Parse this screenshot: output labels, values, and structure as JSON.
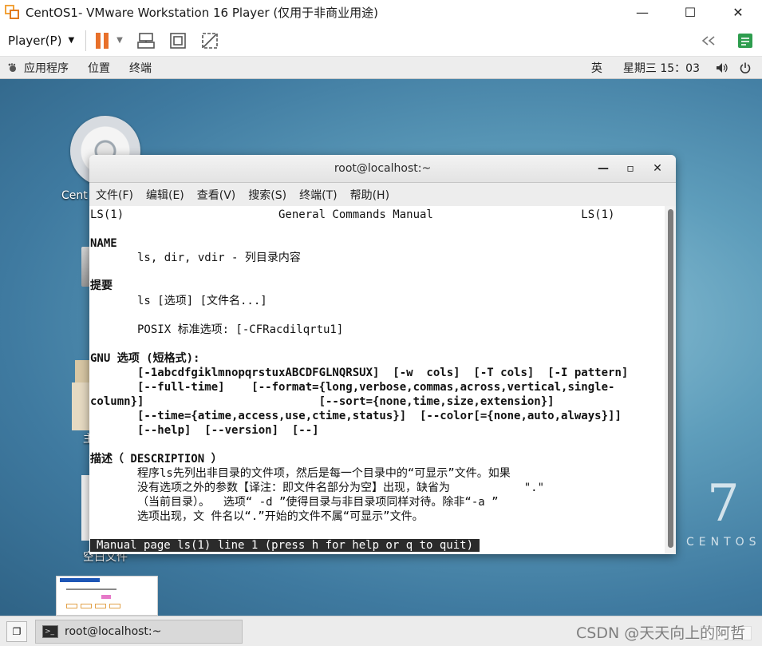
{
  "vmware": {
    "title": "CentOS1- VMware Workstation 16 Player (仅用于非商业用途)",
    "player_menu": "Player(P)",
    "controls": {
      "minimize": "—",
      "maximize": "☐",
      "close": "✕"
    }
  },
  "gnome": {
    "apps": "应用程序",
    "places": "位置",
    "terminal": "终端",
    "input_method": "英",
    "clock": "星期三 15：03"
  },
  "desktop": {
    "partial_label_cd": "Cent",
    "partial_label_folder": "主",
    "label_empty_file": "空白文件",
    "centos_seven": "7",
    "centos_word": "CENTOS"
  },
  "terminal": {
    "title": "root@localhost:~",
    "menu": [
      "文件(F)",
      "编辑(E)",
      "查看(V)",
      "搜索(S)",
      "终端(T)",
      "帮助(H)"
    ],
    "controls": {
      "minimize": "—",
      "maximize": "▫",
      "close": "✕"
    },
    "lines": {
      "header": "LS(1)                       General Commands Manual                      LS(1)",
      "name_heading": "NAME",
      "name_text": "       ls, dir, vdir - 列目录内容",
      "synopsis_heading": "提要",
      "synopsis_1": "       ls [选项] [文件名...]",
      "synopsis_2": "       POSIX 标准选项: [-CFRacdilqrtu1]",
      "gnu_heading": "GNU 选项 (短格式):",
      "gnu_1": "       [-1abcdfgiklmnopqrstuxABCDFGLNQRSUX]  [-w  cols]  [-T cols]  [-I pattern]",
      "gnu_2": "       [--full-time]    [--format={long,verbose,commas,across,vertical,single-",
      "gnu_3": "column}]                          [--sort={none,time,size,extension}]",
      "gnu_4": "       [--time={atime,access,use,ctime,status}]  [--color[={none,auto,always}]]",
      "gnu_5": "       [--help]  [--version]  [--]",
      "desc_heading": "描述（ DESCRIPTION ）",
      "desc_1": "       程序ls先列出非目录的文件项，然后是每一个目录中的“可显示”文件。如果",
      "desc_2": "       没有选项之外的参数【译注：即文件名部分为空】出现，缺省为           \".\"",
      "desc_3": "       （当前目录）。  选项“ -d ”使得目录与非目录项同样对待。除非“-a ”",
      "desc_4": "       选项出现，文 件名以“.”开始的文件不属“可显示”文件。",
      "status": "Manual page ls(1) line 1 (press h for help or q to quit)"
    }
  },
  "taskbar": {
    "task_label": "root@localhost:~",
    "watermark": "CSDN @天天向上的阿哲"
  }
}
